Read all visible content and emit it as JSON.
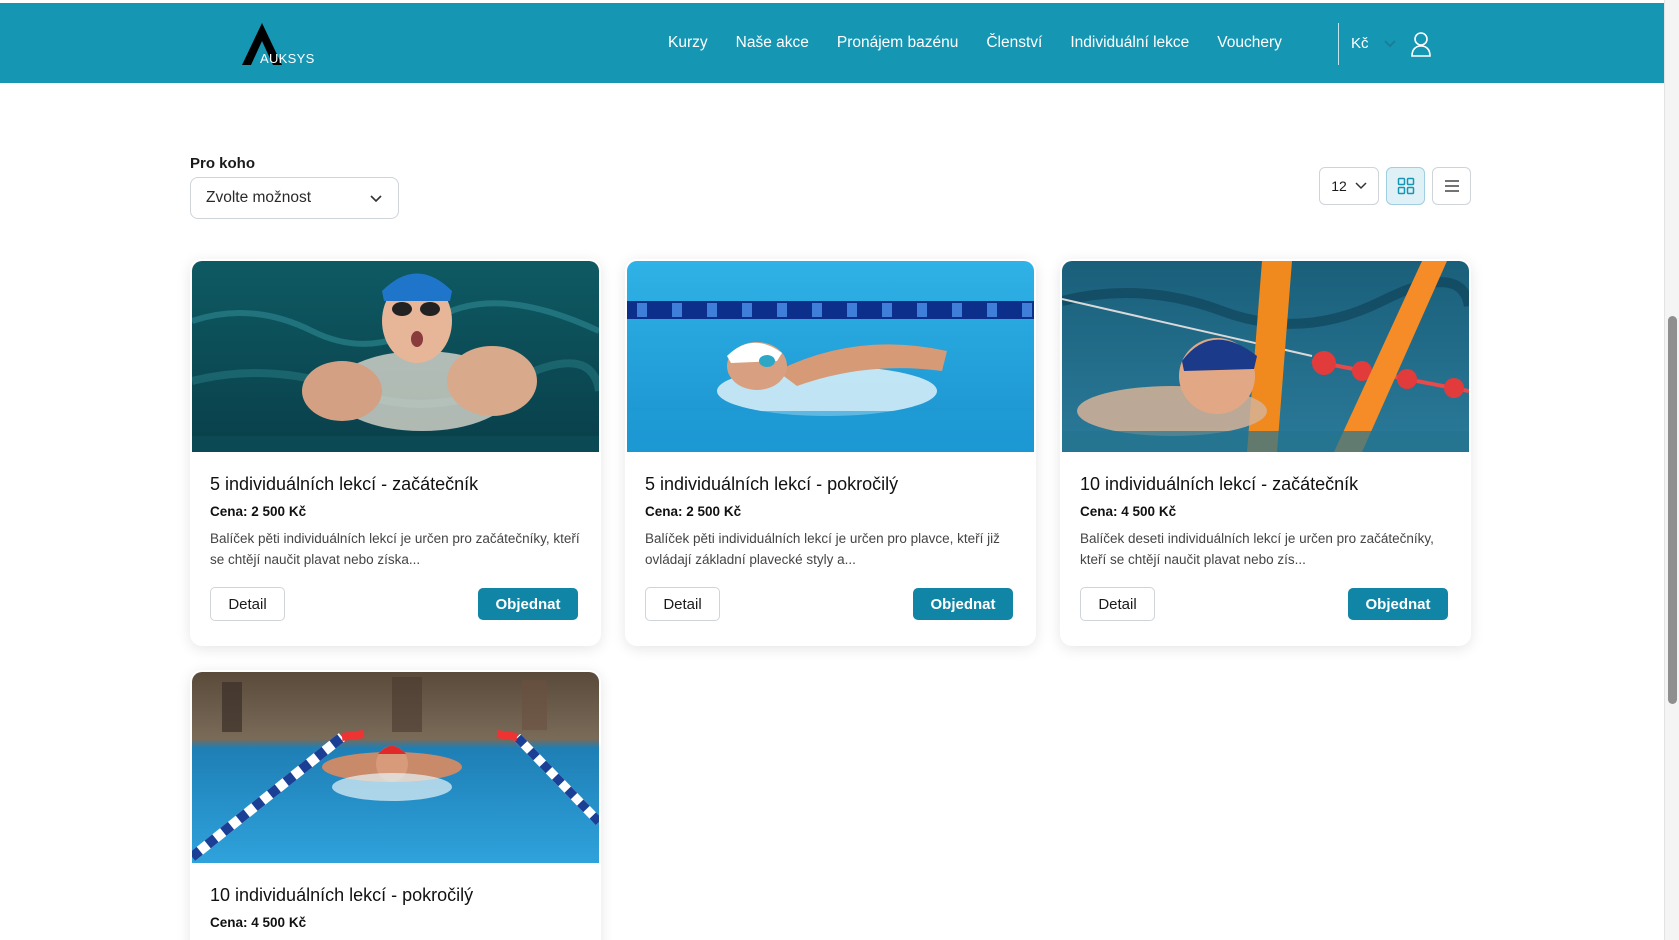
{
  "header": {
    "logo_text": "AUKSYS",
    "nav": [
      "Kurzy",
      "Naše akce",
      "Pronájem bazénu",
      "Členství",
      "Individuální lekce",
      "Vouchery"
    ],
    "currency": "Kč",
    "colors": {
      "bar": "#1596b3"
    }
  },
  "filter": {
    "label": "Pro koho",
    "select_value": "Zvolte možnost"
  },
  "toolbar": {
    "per_page": "12",
    "view_modes": [
      "grid-icon",
      "list-icon"
    ],
    "active_view": "grid"
  },
  "cards": [
    {
      "title": "5 individuálních lekcí - začátečník",
      "price_label": "Cena:",
      "price": "2 500 Kč",
      "description": "Balíček pěti individuálních lekcí je určen pro začátečníky, kteří se chtějí naučit plavat nebo získa...",
      "detail_label": "Detail",
      "order_label": "Objednat"
    },
    {
      "title": "5 individuálních lekcí - pokročilý",
      "price_label": "Cena:",
      "price": "2 500 Kč",
      "description": "Balíček pěti individuálních lekcí je určen pro plavce, kteří již ovládají základní plavecké styly a...",
      "detail_label": "Detail",
      "order_label": "Objednat"
    },
    {
      "title": "10 individuálních lekcí - začátečník",
      "price_label": "Cena:",
      "price": "4 500 Kč",
      "description": "Balíček deseti individuálních lekcí je určen pro začátečníky, kteří se chtějí naučit plavat nebo zís...",
      "detail_label": "Detail",
      "order_label": "Objednat"
    },
    {
      "title": "10 individuálních lekcí - pokročilý",
      "price_label": "Cena:",
      "price": "4 500 Kč"
    }
  ],
  "colors": {
    "accent": "#1185a6",
    "active_view_bg": "#dff0f6"
  }
}
